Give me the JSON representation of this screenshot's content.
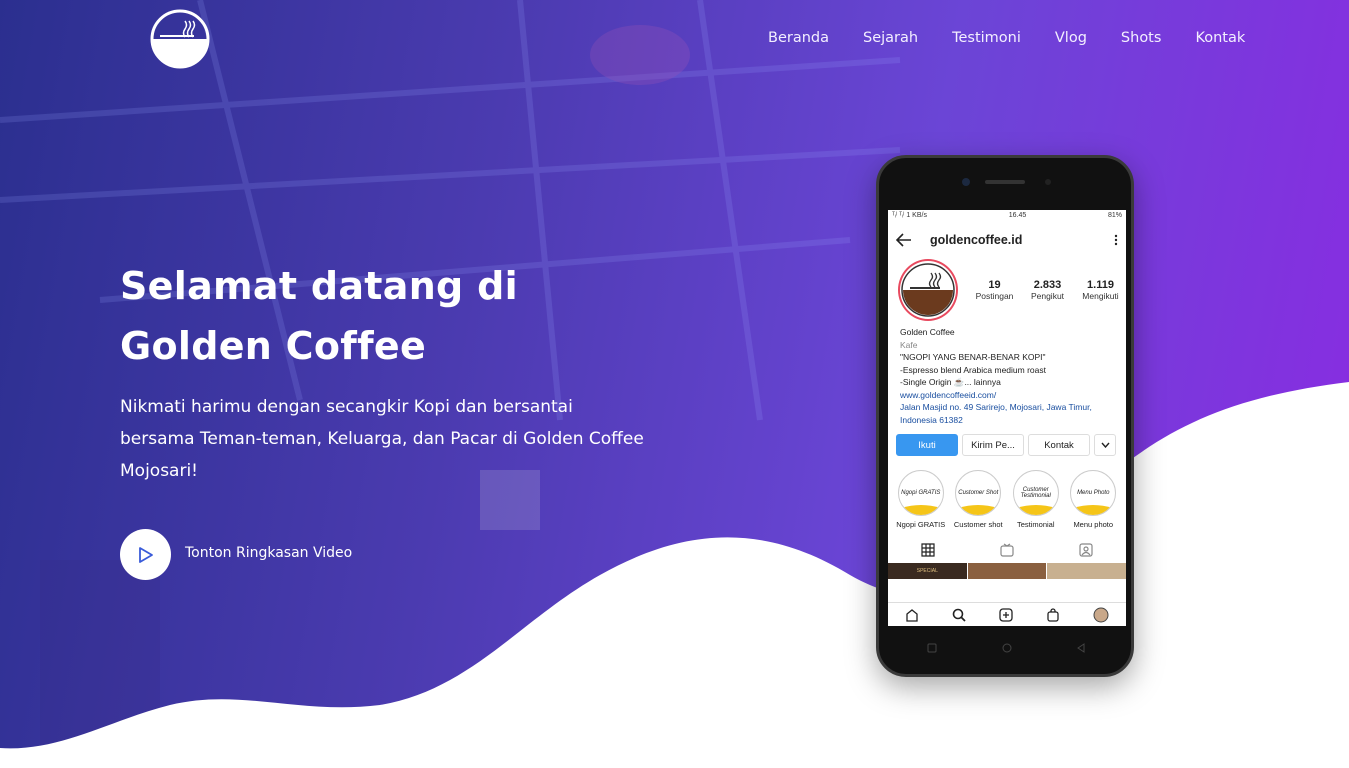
{
  "nav": {
    "items": [
      "Beranda",
      "Sejarah",
      "Testimoni",
      "Vlog",
      "Shots",
      "Kontak"
    ]
  },
  "hero": {
    "title_line1": "Selamat datang di",
    "title_line2": "Golden Coffee",
    "subtitle_line1": "Nikmati harimu dengan secangkir Kopi dan bersantai",
    "subtitle_line2": "bersama Teman-teman, Keluarga, dan Pacar di Golden Coffee",
    "subtitle_line3": "Mojosari!",
    "video_label": "Tonton Ringkasan Video"
  },
  "phone": {
    "status_left": "ᵀᵢˡ ᵀᵢˡ 1 KB/s",
    "status_time": "16.45",
    "status_right": "81%",
    "username": "goldencoffee.id",
    "posts_count": "19",
    "posts_label": "Postingan",
    "followers_count": "2.833",
    "followers_label": "Pengikut",
    "following_count": "1.119",
    "following_label": "Mengikuti",
    "bio_name": "Golden Coffee",
    "bio_category": "Kafe",
    "bio_line1": "\"NGOPI YANG BENAR-BENAR KOPI\"",
    "bio_line2": "-Espresso blend Arabica medium roast",
    "bio_line3": "-Single Origin ☕... lainnya",
    "bio_link": "www.goldencoffeeid.com/",
    "bio_address1": "Jalan Masjid no. 49 Sarirejo, Mojosari, Jawa Timur,",
    "bio_address2": "Indonesia 61382",
    "btn_follow": "Ikuti",
    "btn_message": "Kirim Pe...",
    "btn_contact": "Kontak",
    "highlights": [
      {
        "cover": "Ngopi GRATIS",
        "label": "Ngopi GRATIS"
      },
      {
        "cover": "Customer Shot",
        "label": "Customer shot"
      },
      {
        "cover": "Customer Testimonial",
        "label": "Testimonial"
      },
      {
        "cover": "Menu Photo",
        "label": "Menu photo"
      }
    ],
    "grid_text": "SPECIAL"
  },
  "colors": {
    "gradient_start": "#2b2f8f",
    "gradient_end": "#8a2be2",
    "ig_blue": "#3897f0",
    "play_icon": "#3a5bd9"
  },
  "icons": [
    "logo-cup-icon",
    "play-icon",
    "back-arrow-icon",
    "more-vert-icon",
    "chevron-down-icon",
    "grid-icon",
    "igtv-icon",
    "tagged-icon",
    "home-icon",
    "search-icon",
    "add-icon",
    "shop-icon",
    "profile-icon"
  ]
}
